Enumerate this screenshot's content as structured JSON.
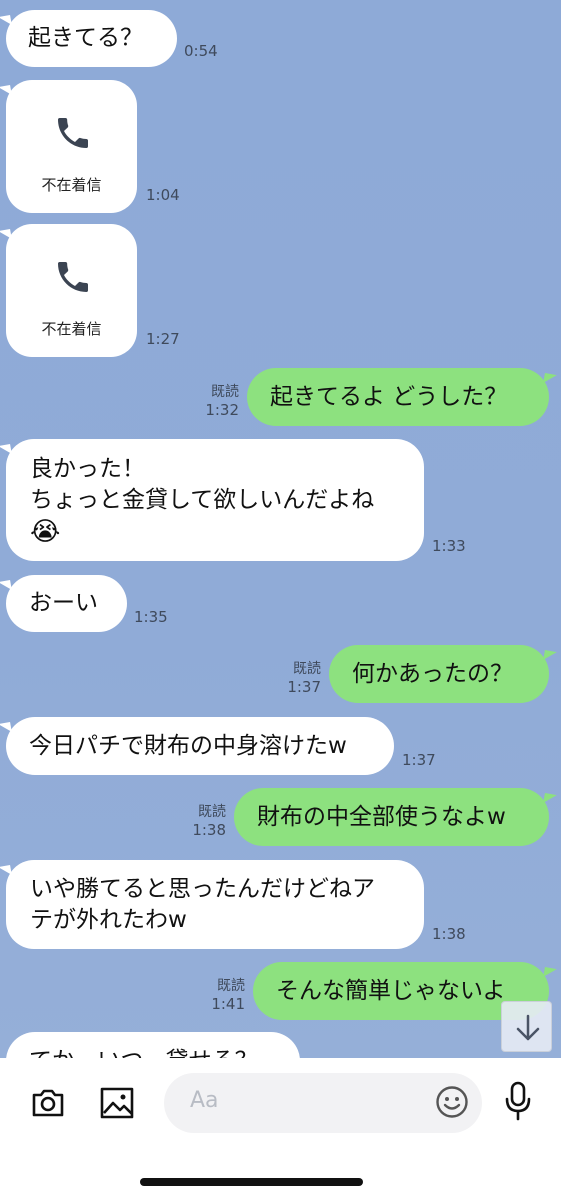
{
  "messages": {
    "m1": {
      "text": "起きてる？",
      "time": "0:54"
    },
    "m2": {
      "label": "不在着信",
      "time": "1:04"
    },
    "m3": {
      "label": "不在着信",
      "time": "1:27"
    },
    "m4": {
      "text": "起きてるよ どうした？",
      "read": "既読",
      "time": "1:32"
    },
    "m5": {
      "line1": "良かった！",
      "line2": "ちょっと金貸して欲しいんだよね",
      "line3": "😭",
      "time": "1:33"
    },
    "m6": {
      "text": "おーい",
      "time": "1:35"
    },
    "m7": {
      "text": "何かあったの？",
      "read": "既読",
      "time": "1:37"
    },
    "m8": {
      "text": "今日パチで財布の中身溶けたw",
      "time": "1:37"
    },
    "m9": {
      "text": "財布の中全部使うなよw",
      "read": "既読",
      "time": "1:38"
    },
    "m10": {
      "line1": "いや勝てると思ったんだけどねア",
      "line2": "テが外れたわw",
      "time": "1:38"
    },
    "m11": {
      "text": "そんな簡単じゃないよ",
      "read": "既読",
      "time": "1:41"
    },
    "m12": {
      "text": "てか、いつ、貸せる？"
    }
  },
  "composer": {
    "placeholder": "Aa"
  },
  "colors": {
    "background": "#8faad6",
    "incoming": "#ffffff",
    "outgoing": "#8de17f"
  },
  "icons": [
    "phone-icon",
    "arrow-down-icon",
    "camera-icon",
    "image-icon",
    "emoji-icon",
    "microphone-icon"
  ]
}
